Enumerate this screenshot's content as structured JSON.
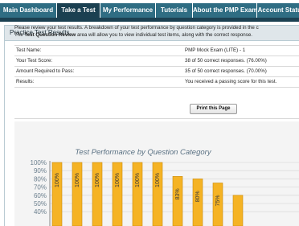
{
  "nav": {
    "tabs": [
      {
        "label": "Main Dashboard",
        "active": false
      },
      {
        "label": "Take a Test",
        "active": true
      },
      {
        "label": "My Performance",
        "active": false
      },
      {
        "label": "Tutorials",
        "active": false
      },
      {
        "label": "About the PMP Exam",
        "active": false
      },
      {
        "label": "Account Status",
        "active": false
      }
    ]
  },
  "panel": {
    "title": "Practice Test Results",
    "intro_line1": "Please review your test results. A breakdown of your test performance by question category is provided in the c",
    "intro_line2_prefix": "The ",
    "intro_line2_bold": "Test Question Review",
    "intro_line2_suffix": " area will allow you to view individual test items, along with the correct response."
  },
  "results": [
    {
      "label": "Test Name:",
      "value": "PMP Mock Exam (LITE) - 1"
    },
    {
      "label": "Your Test Score:",
      "value": "38 of 50 correct responses. (76.00%)"
    },
    {
      "label": "Amount Required to Pass:",
      "value": "35 of 50 correct responses. (70.00%)"
    },
    {
      "label": "Results:",
      "value": "You received a passing score for this test."
    }
  ],
  "print_button": "Print this Page",
  "colors": {
    "nav_tab": "#2f6d83",
    "nav_tab_active": "#1b4051",
    "bar_fill": "#f5b324",
    "bar_edge": "#c98a0c"
  },
  "chart_data": {
    "type": "bar",
    "title": "Test Performance by Question Category",
    "ylim": [
      40,
      100
    ],
    "yticks": [
      "100%",
      "90%",
      "80%",
      "70%",
      "60%",
      "50%",
      "40%"
    ],
    "values": [
      100,
      100,
      100,
      100,
      100,
      100,
      83,
      80,
      75,
      60
    ],
    "bar_labels": [
      "100%",
      "100%",
      "100%",
      "100%",
      "100%",
      "100%",
      "83%",
      "80%",
      "75%",
      ""
    ],
    "grid": true
  }
}
